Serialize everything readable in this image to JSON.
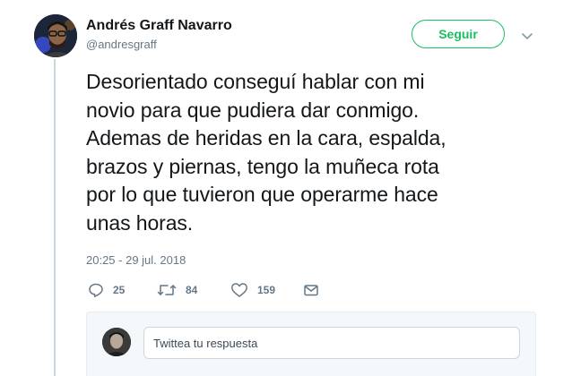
{
  "author": {
    "name": "Andrés Graff Navarro",
    "handle": "@andresgraff"
  },
  "follow_button": {
    "label": "Seguir"
  },
  "tweet": {
    "lines": [
      "Desorientado conseguí hablar con mi",
      "novio para que pudiera dar conmigo.",
      "Ademas de heridas en la cara, espalda,",
      "brazos y piernas, tengo la muñeca rota",
      "por lo que tuvieron que operarme hace",
      "unas horas."
    ],
    "timestamp": "20:25 - 29 jul. 2018"
  },
  "actions": {
    "replies": "25",
    "retweets": "84",
    "likes": "159"
  },
  "icons": {
    "reply": "reply-icon",
    "retweet": "retweet-icon",
    "like": "heart-icon",
    "message": "envelope-icon",
    "more": "chevron-down-icon"
  },
  "reply": {
    "placeholder": "Twittea tu respuesta"
  },
  "colors": {
    "follow_green": "#17bf63",
    "muted_text": "#657786",
    "thread_line": "#ccd6dd"
  }
}
